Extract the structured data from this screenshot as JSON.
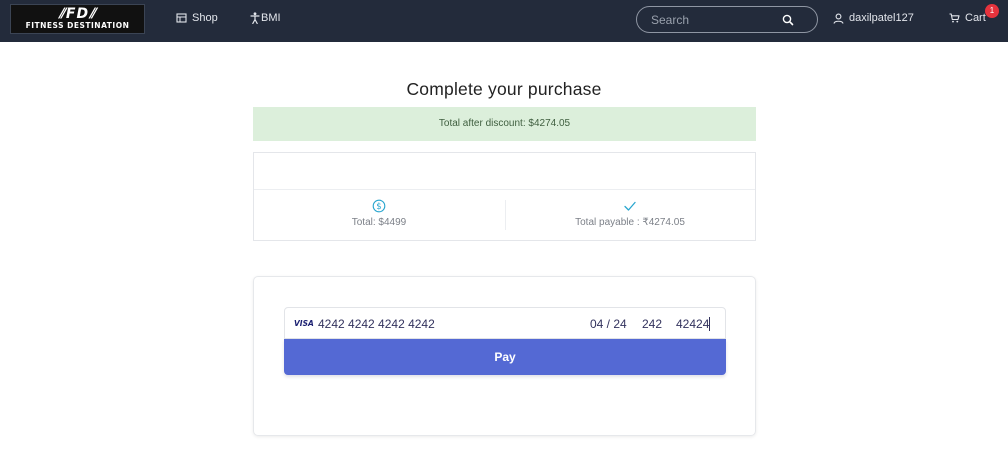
{
  "navbar": {
    "logo": {
      "mark": "⫽FD⫽",
      "text": "FITNESS DESTINATION"
    },
    "links": [
      {
        "label": "Shop",
        "icon": "store-icon"
      },
      {
        "label": "BMI",
        "icon": "person-icon"
      }
    ],
    "search": {
      "placeholder": "Search",
      "value": "",
      "icon": "search-icon"
    },
    "user": {
      "label": "daxilpatel127",
      "icon": "user-icon"
    },
    "cart": {
      "label": "Cart",
      "badge": "1",
      "icon": "cart-icon"
    }
  },
  "page": {
    "title": "Complete your purchase",
    "discount_alert": "Total after discount: $4274.05"
  },
  "summary": {
    "total": {
      "label": "Total: $4499",
      "icon": "dollar-circle-icon"
    },
    "payable": {
      "label": "Total payable : ₹4274.05",
      "icon": "check-icon"
    }
  },
  "payment": {
    "brand": "VISA",
    "card_number": "4242 4242 4242 4242",
    "expiry": "04 / 24",
    "cvc": "242",
    "zip": "42424",
    "pay_label": "Pay"
  },
  "colors": {
    "navbar_bg": "#232b3b",
    "alert_bg": "#dcefdb",
    "pay_button": "#5469d4",
    "badge": "#e6333d",
    "accent_icon": "#2aa6cf"
  }
}
